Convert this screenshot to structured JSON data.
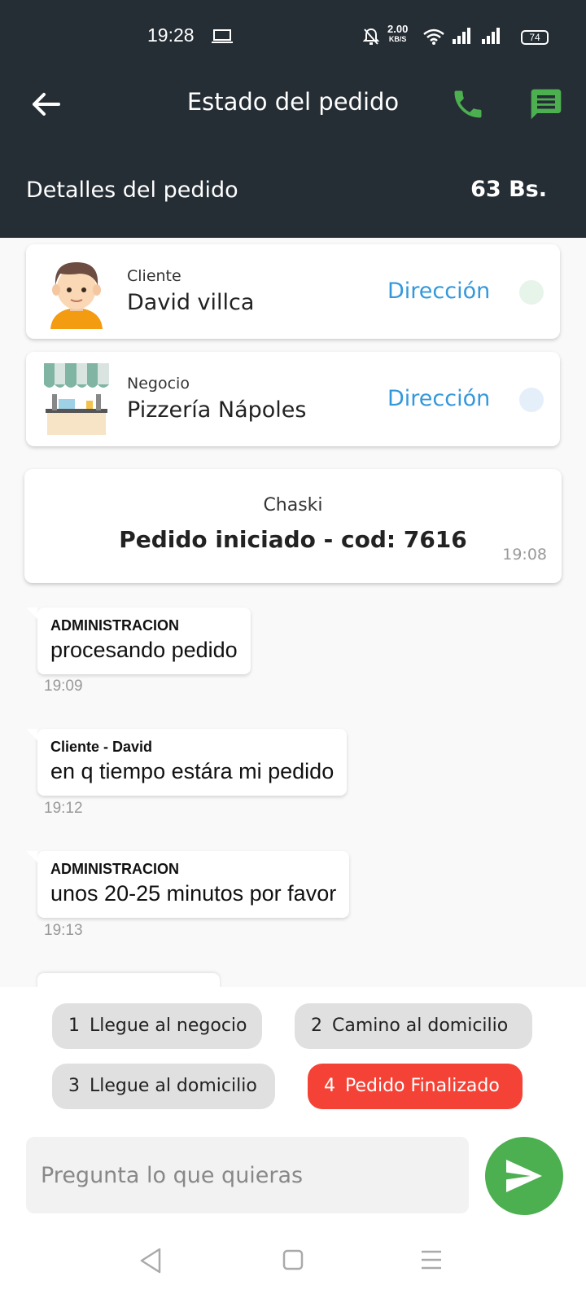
{
  "status_bar": {
    "time": "19:28",
    "network_speed_value": "2.00",
    "network_speed_unit": "KB/S",
    "battery": "74"
  },
  "header": {
    "title": "Estado del pedido",
    "details_label": "Detalles del pedido",
    "total": "63 Bs."
  },
  "client_card": {
    "role": "Cliente",
    "name": "David villca",
    "direction_label": "Dirección",
    "dot_color": "#e6f4ea"
  },
  "business_card": {
    "role": "Negocio",
    "name": "Pizzería Nápoles",
    "direction_label": "Dirección",
    "dot_color": "#e5effa"
  },
  "chaski": {
    "sender": "Chaski",
    "message": "Pedido iniciado - cod: 7616",
    "time": "19:08"
  },
  "messages": [
    {
      "sender": "ADMINISTRACION",
      "text": "procesando pedido",
      "time": "19:09"
    },
    {
      "sender": "Cliente - David",
      "text": "en q tiempo estára mi pedido",
      "time": "19:12"
    },
    {
      "sender": "ADMINISTRACION",
      "text": "unos 20-25 minutos por favor",
      "time": "19:13"
    }
  ],
  "steps": [
    {
      "num": "1",
      "label": "Llegue al negocio"
    },
    {
      "num": "2",
      "label": "Camino al domicilio"
    },
    {
      "num": "3",
      "label": "Llegue al domicilio"
    },
    {
      "num": "4",
      "label": "Pedido Finalizado"
    }
  ],
  "input": {
    "placeholder": "Pregunta lo que quieras"
  },
  "colors": {
    "header_bg": "#252d35",
    "accent_green": "#4caf50",
    "link_blue": "#3498db",
    "active_step": "#f44336"
  }
}
